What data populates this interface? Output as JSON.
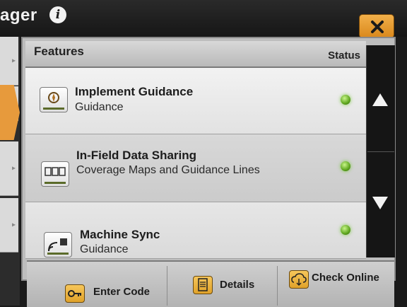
{
  "window": {
    "title": "ager"
  },
  "table": {
    "header": {
      "features": "Features",
      "status": "Status"
    },
    "rows": [
      {
        "title": "Implement Guidance",
        "subtitle": "Guidance",
        "status": "active",
        "icon": "implement-guidance-icon"
      },
      {
        "title": "In-Field Data Sharing",
        "subtitle": "Coverage Maps and Guidance Lines",
        "status": "active",
        "icon": "data-sharing-icon"
      },
      {
        "title": "Machine Sync",
        "subtitle": "Guidance",
        "status": "active",
        "icon": "machine-sync-icon"
      }
    ]
  },
  "footer": {
    "enter_code": "Enter Code",
    "details": "Details",
    "check_online": "Check Online"
  },
  "colors": {
    "accent": "#e79a3c",
    "status_on": "#5ea61e",
    "panel": "#d6d6d6",
    "titlebar": "#1a1a1a"
  }
}
